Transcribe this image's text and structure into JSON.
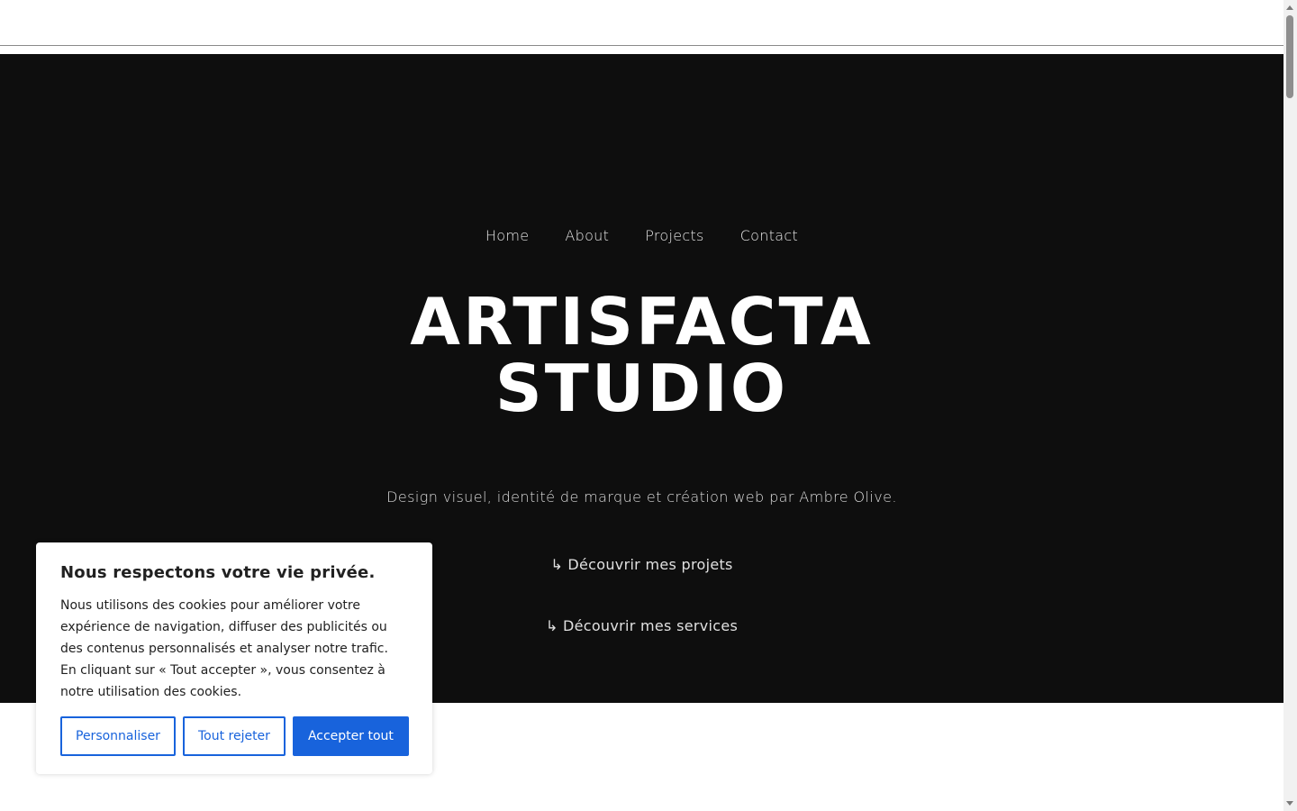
{
  "nav": {
    "items": [
      {
        "label": "Home"
      },
      {
        "label": "About"
      },
      {
        "label": "Projects"
      },
      {
        "label": "Contact"
      }
    ]
  },
  "hero": {
    "title_line1": "ARTISFACTA",
    "title_line2": "STUDIO",
    "tagline": "Design visuel, identité de marque et création web par Ambre Olive.",
    "cta_projects": "↳ Découvrir mes projets",
    "cta_services": "↳ Découvrir mes services"
  },
  "cookie": {
    "title": "Nous respectons votre vie privée.",
    "text": "Nous utilisons des cookies pour améliorer votre expérience de navigation, diffuser des publicités ou des contenus personnalisés et analyser notre trafic. En cliquant sur « Tout accepter », vous consentez à notre utilisation des cookies.",
    "customize_label": "Personnaliser",
    "reject_label": "Tout rejeter",
    "accept_label": "Accepter tout"
  },
  "colors": {
    "hero_bg": "#0e0e0e",
    "accent": "#1863dc"
  }
}
